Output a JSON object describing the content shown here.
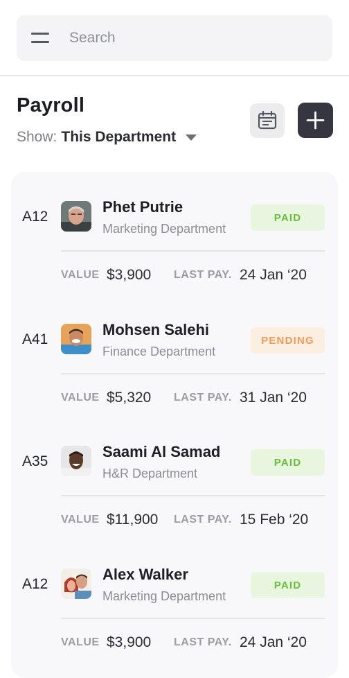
{
  "search": {
    "placeholder": "Search"
  },
  "header": {
    "title": "Payroll",
    "show_label": "Show:",
    "show_value": "This Department"
  },
  "labels": {
    "value": "VALUE",
    "last_pay": "LAST PAY."
  },
  "employees": [
    {
      "id": "A12",
      "name": "Phet Putrie",
      "department": "Marketing Department",
      "status": "PAID",
      "value": "$3,900",
      "last_pay": "24 Jan ‘20",
      "avatar": "avatar-older-man"
    },
    {
      "id": "A41",
      "name": "Mohsen Salehi",
      "department": "Finance Department",
      "status": "PENDING",
      "value": "$5,320",
      "last_pay": "31 Jan ‘20",
      "avatar": "avatar-man-blue-shirt"
    },
    {
      "id": "A35",
      "name": "Saami Al Samad",
      "department": "H&R Department",
      "status": "PAID",
      "value": "$11,900",
      "last_pay": "15 Feb ‘20",
      "avatar": "avatar-smiling-man"
    },
    {
      "id": "A12",
      "name": "Alex Walker",
      "department": "Marketing Department",
      "status": "PAID",
      "value": "$3,900",
      "last_pay": "24 Jan ‘20",
      "avatar": "avatar-couple"
    }
  ],
  "colors": {
    "paid_bg": "#e8f6df",
    "paid_text": "#6abf3a",
    "pending_bg": "#fdeee2",
    "pending_text": "#f29a54",
    "add_button": "#353640"
  },
  "icons": {
    "menu": "menu-icon",
    "calendar": "calendar-icon",
    "add": "plus-icon",
    "dropdown": "caret-down-icon"
  }
}
